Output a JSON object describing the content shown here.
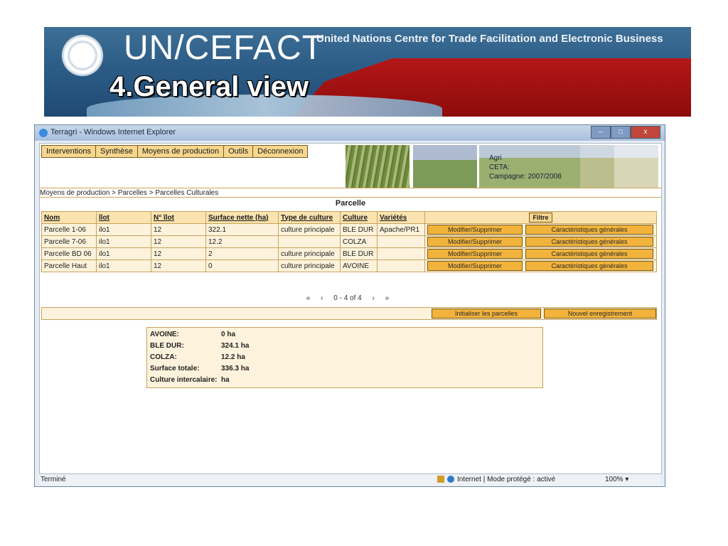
{
  "banner": {
    "org": "UN/CEFACT",
    "subtitle": "United Nations Centre for Trade Facilitation and Electronic Business",
    "headline": "4.General view"
  },
  "window": {
    "title": "Terragri - Windows Internet Explorer",
    "min": "–",
    "max": "□",
    "close": "x"
  },
  "menu": [
    "Interventions",
    "Synthèse",
    "Moyens de production",
    "Outils",
    "Déconnexion"
  ],
  "agri": {
    "line1": "Agri",
    "line2": "CETA:",
    "line3": "Campagne: 2007/2008"
  },
  "breadcrumb": "Moyens de production > Parcelles > Parcelles Culturales",
  "section_title": "Parcelle",
  "table": {
    "headers": [
      "Nom",
      "îlot",
      "N° îlot",
      "Surface nette (ha)",
      "Type de culture",
      "Culture",
      "Variétés"
    ],
    "filter": "Filtre",
    "rows": [
      {
        "nom": "Parcelle 1-06",
        "ilot": "ilo1",
        "num": "12",
        "surface": "322.1",
        "type": "culture principale",
        "culture": "BLE DUR",
        "varietes": "Apache/PR1"
      },
      {
        "nom": "Parcelle 7-06",
        "ilot": "ilo1",
        "num": "12",
        "surface": "12.2",
        "type": "",
        "culture": "COLZA",
        "varietes": ""
      },
      {
        "nom": "Parcelle BD 06",
        "ilot": "ilo1",
        "num": "12",
        "surface": "2",
        "type": "culture principale",
        "culture": "BLE DUR",
        "varietes": ""
      },
      {
        "nom": "Parcelle Haut",
        "ilot": "ilo1",
        "num": "12",
        "surface": "0",
        "type": "culture principale",
        "culture": "AVOINE",
        "varietes": ""
      }
    ],
    "btn_modify": "Modifier/Supprimer",
    "btn_chars": "Caractéristiques générales"
  },
  "pager": {
    "first": "«",
    "prev": "‹",
    "range": "0 - 4 of 4",
    "next": "›",
    "last": "»"
  },
  "actions": {
    "init": "Initialiser les parcelles",
    "new": "Nouvel enregistrement"
  },
  "summary": [
    {
      "label": "AVOINE:",
      "value": "0 ha"
    },
    {
      "label": "BLE DUR:",
      "value": "324.1 ha"
    },
    {
      "label": "COLZA:",
      "value": "12.2 ha"
    },
    {
      "label": "Surface totale:",
      "value": "336.3 ha"
    },
    {
      "label": "Culture intercalaire:",
      "value": "ha"
    }
  ],
  "status": {
    "done": "Terminé",
    "zone": "Internet | Mode protégé : activé",
    "zoom": "100%  ▾"
  }
}
